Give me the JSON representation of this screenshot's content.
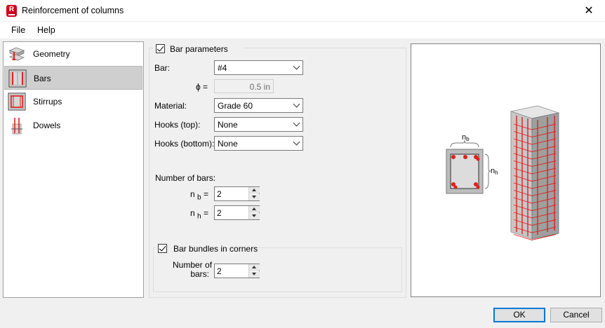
{
  "window": {
    "title": "Reinforcement of columns",
    "icon_letter": "R"
  },
  "menu": {
    "file": "File",
    "help": "Help"
  },
  "nav": {
    "items": [
      {
        "label": "Geometry",
        "icon": "geometry-icon"
      },
      {
        "label": "Bars",
        "icon": "bars-icon"
      },
      {
        "label": "Stirrups",
        "icon": "stirrups-icon"
      },
      {
        "label": "Dowels",
        "icon": "dowels-icon"
      }
    ],
    "selected": "Bars"
  },
  "bar_parameters": {
    "checkbox_label": "Bar parameters",
    "checked": true,
    "bar_label": "Bar:",
    "bar_value": "#4",
    "phi_label": "ϕ =",
    "phi_value": "0.5 in",
    "material_label": "Material:",
    "material_value": "Grade 60",
    "hooks_top_label": "Hooks (top):",
    "hooks_top_value": "None",
    "hooks_bottom_label": "Hooks (bottom):",
    "hooks_bottom_value": "None",
    "number_of_bars_label": "Number of bars:",
    "nb_label": "n",
    "nb_sub": "b",
    "nb_eq": "=",
    "nb_value": "2",
    "nh_label": "n",
    "nh_sub": "h",
    "nh_eq": "=",
    "nh_value": "2"
  },
  "bundles": {
    "checkbox_label": "Bar bundles in corners",
    "checked": true,
    "number_label_line1": "Number of",
    "number_label_line2": "bars:",
    "number_value": "2"
  },
  "preview": {
    "nb_label": "n",
    "nb_sub": "b",
    "nh_label": "n",
    "nh_sub": "h"
  },
  "buttons": {
    "ok": "OK",
    "cancel": "Cancel"
  },
  "colors": {
    "rebar_red": "#e0201c",
    "ok_border": "#0078d7",
    "concrete": "#c8c8c8"
  }
}
